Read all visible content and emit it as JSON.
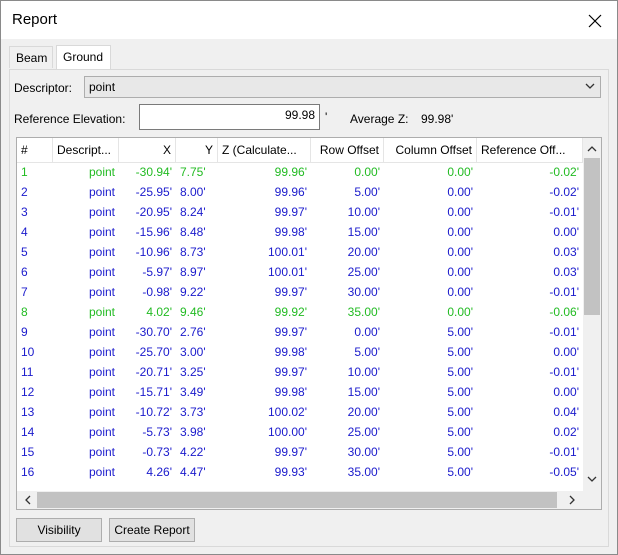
{
  "window": {
    "title": "Report"
  },
  "tabs": [
    {
      "label": "Beam"
    },
    {
      "label": "Ground"
    }
  ],
  "descriptor": {
    "label": "Descriptor:",
    "value": "point"
  },
  "reference": {
    "label": "Reference Elevation:",
    "value": "99.98",
    "unit": "'"
  },
  "average": {
    "label": "Average Z:",
    "value": "99.98'"
  },
  "grid": {
    "columns": [
      "#",
      "Descript...",
      "X",
      "Y",
      "Z (Calculate...",
      "Row Offset",
      "Column Offset",
      "Reference Off..."
    ],
    "rows": [
      {
        "n": "1",
        "d": "point",
        "x": "-30.94'",
        "y": "7.75'",
        "z": "99.96'",
        "ro": "0.00'",
        "co": "0.00'",
        "rf": "-0.02'",
        "color": "#22bb22"
      },
      {
        "n": "2",
        "d": "point",
        "x": "-25.95'",
        "y": "8.00'",
        "z": "99.96'",
        "ro": "5.00'",
        "co": "0.00'",
        "rf": "-0.02'",
        "color": "#1a1acc"
      },
      {
        "n": "3",
        "d": "point",
        "x": "-20.95'",
        "y": "8.24'",
        "z": "99.97'",
        "ro": "10.00'",
        "co": "0.00'",
        "rf": "-0.01'",
        "color": "#1a1acc"
      },
      {
        "n": "4",
        "d": "point",
        "x": "-15.96'",
        "y": "8.48'",
        "z": "99.98'",
        "ro": "15.00'",
        "co": "0.00'",
        "rf": "0.00'",
        "color": "#1a1acc"
      },
      {
        "n": "5",
        "d": "point",
        "x": "-10.96'",
        "y": "8.73'",
        "z": "100.01'",
        "ro": "20.00'",
        "co": "0.00'",
        "rf": "0.03'",
        "color": "#1a1acc"
      },
      {
        "n": "6",
        "d": "point",
        "x": "-5.97'",
        "y": "8.97'",
        "z": "100.01'",
        "ro": "25.00'",
        "co": "0.00'",
        "rf": "0.03'",
        "color": "#1a1acc"
      },
      {
        "n": "7",
        "d": "point",
        "x": "-0.98'",
        "y": "9.22'",
        "z": "99.97'",
        "ro": "30.00'",
        "co": "0.00'",
        "rf": "-0.01'",
        "color": "#1a1acc"
      },
      {
        "n": "8",
        "d": "point",
        "x": "4.02'",
        "y": "9.46'",
        "z": "99.92'",
        "ro": "35.00'",
        "co": "0.00'",
        "rf": "-0.06'",
        "color": "#22bb22"
      },
      {
        "n": "9",
        "d": "point",
        "x": "-30.70'",
        "y": "2.76'",
        "z": "99.97'",
        "ro": "0.00'",
        "co": "5.00'",
        "rf": "-0.01'",
        "color": "#1a1acc"
      },
      {
        "n": "10",
        "d": "point",
        "x": "-25.70'",
        "y": "3.00'",
        "z": "99.98'",
        "ro": "5.00'",
        "co": "5.00'",
        "rf": "0.00'",
        "color": "#1a1acc"
      },
      {
        "n": "11",
        "d": "point",
        "x": "-20.71'",
        "y": "3.25'",
        "z": "99.97'",
        "ro": "10.00'",
        "co": "5.00'",
        "rf": "-0.01'",
        "color": "#1a1acc"
      },
      {
        "n": "12",
        "d": "point",
        "x": "-15.71'",
        "y": "3.49'",
        "z": "99.98'",
        "ro": "15.00'",
        "co": "5.00'",
        "rf": "0.00'",
        "color": "#1a1acc"
      },
      {
        "n": "13",
        "d": "point",
        "x": "-10.72'",
        "y": "3.73'",
        "z": "100.02'",
        "ro": "20.00'",
        "co": "5.00'",
        "rf": "0.04'",
        "color": "#1a1acc"
      },
      {
        "n": "14",
        "d": "point",
        "x": "-5.73'",
        "y": "3.98'",
        "z": "100.00'",
        "ro": "25.00'",
        "co": "5.00'",
        "rf": "0.02'",
        "color": "#1a1acc"
      },
      {
        "n": "15",
        "d": "point",
        "x": "-0.73'",
        "y": "4.22'",
        "z": "99.97'",
        "ro": "30.00'",
        "co": "5.00'",
        "rf": "-0.01'",
        "color": "#1a1acc"
      },
      {
        "n": "16",
        "d": "point",
        "x": "4.26'",
        "y": "4.47'",
        "z": "99.93'",
        "ro": "35.00'",
        "co": "5.00'",
        "rf": "-0.05'",
        "color": "#1a1acc"
      }
    ]
  },
  "buttons": {
    "visibility": "Visibility",
    "create_report": "Create Report"
  },
  "icons": {
    "close": "close-icon",
    "dropdown": "chevron-down-icon"
  }
}
